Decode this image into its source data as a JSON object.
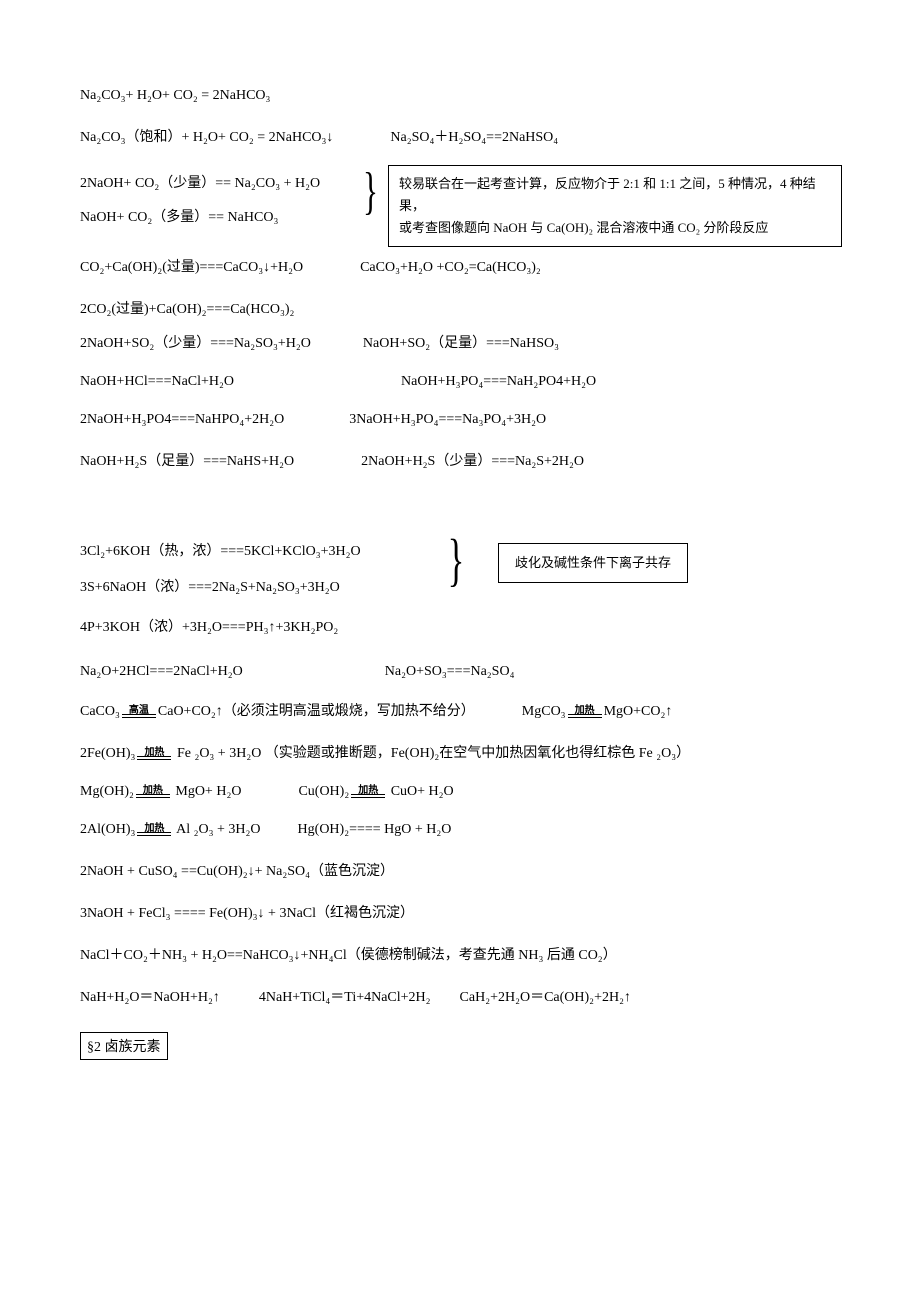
{
  "eq1": "Na₂CO₃+ H₂O+ CO₂ = 2NaHCO₃",
  "eq2a": "Na₂CO₃（饱和）+ H₂O+ CO₂ = 2NaHCO₃↓",
  "eq2b": "Na₂SO₄＋H₂SO₄==2NaHSO₄",
  "eq3": "2NaOH+ CO₂（少量）== Na₂CO₃ + H₂O",
  "eq4": "NaOH+ CO₂（多量）== NaHCO₃",
  "note1a": "较易联合在一起考查计算，反应物介于 2:1 和 1:1 之间，5 种情况，4 种结果，",
  "note1b": "或考查图像题向 NaOH 与 Ca(OH)₂ 混合溶液中通 CO₂ 分阶段反应",
  "eq5a": "CO₂+Ca(OH)₂(过量)===CaCO₃↓+H₂O",
  "eq5b": "CaCO₃+H₂O +CO₂=Ca(HCO₃)₂",
  "eq6": "2CO₂(过量)+Ca(OH)₂===Ca(HCO₃)₂",
  "eq7a": "2NaOH+SO₂（少量）===Na₂SO₃+H₂O",
  "eq7b": "NaOH+SO₂（足量）===NaHSO₃",
  "eq8a": "NaOH+HCl===NaCl+H₂O",
  "eq8b": "NaOH+H₃PO₄===NaH₂PO4+H₂O",
  "eq9a": "2NaOH+H₃PO4===NaHPO₄+2H₂O",
  "eq9b": "3NaOH+H₃PO₄===Na₃PO₄+3H₂O",
  "eq10a": "NaOH+H₂S（足量）===NaHS+H₂O",
  "eq10b": "2NaOH+H₂S（少量）===Na₂S+2H₂O",
  "eq11": "3Cl₂+6KOH（热，浓）===5KCl+KClO₃+3H₂O",
  "eq12": "3S+6NaOH（浓）===2Na₂S+Na₂SO₃+3H₂O",
  "note2": "歧化及碱性条件下离子共存",
  "eq13": "4P+3KOH（浓）+3H₂O===PH₃↑+3KH₂PO₂",
  "eq14a": "Na₂O+2HCl===2NaCl+H₂O",
  "eq14b": "Na₂O+SO₃===Na₂SO₄",
  "eq15_l": "CaCO₃",
  "eq15_cond": "高温",
  "eq15_r": "CaO+CO₂↑（必须注明高温或煅烧，写加热不给分）",
  "eq15b_l": "MgCO₃",
  "eq15b_cond": "加热",
  "eq15b_r": "MgO+CO₂↑",
  "eq16_l": "2Fe(OH)₃",
  "eq16_cond": "加热",
  "eq16_r": " Fe ₂O₃ + 3H₂O （实验题或推断题，Fe(OH)₂在空气中加热因氧化也得红棕色 Fe ₂O₃）",
  "eq17a_l": "Mg(OH)₂",
  "eq17a_cond": "加热",
  "eq17a_r": " MgO+ H₂O",
  "eq17b_l": "Cu(OH)₂",
  "eq17b_cond": "加热",
  "eq17b_r": " CuO+ H₂O",
  "eq18a_l": "2Al(OH)₃",
  "eq18a_cond": "加热",
  "eq18a_r": " Al ₂O₃ + 3H₂O",
  "eq18b": "Hg(OH)₂==== HgO + H₂O",
  "eq19": " 2NaOH + CuSO₄ ==Cu(OH)₂↓+ Na₂SO₄（蓝色沉淀）",
  "eq20": "3NaOH + FeCl₃ ==== Fe(OH)₃↓ + 3NaCl（红褐色沉淀）",
  "eq21": "NaCl＋CO₂＋NH₃ + H₂O==NaHCO₃↓+NH₄Cl（侯德榜制碱法，考查先通 NH₃ 后通 CO₂）",
  "eq22a": "NaH+H₂O＝NaOH+H₂↑",
  "eq22b": "4NaH+TiCl₄＝Ti+4NaCl+2H₂",
  "eq22c": "CaH₂+2H₂O＝Ca(OH)₂+2H₂↑",
  "sect": "§2 卤族元素"
}
